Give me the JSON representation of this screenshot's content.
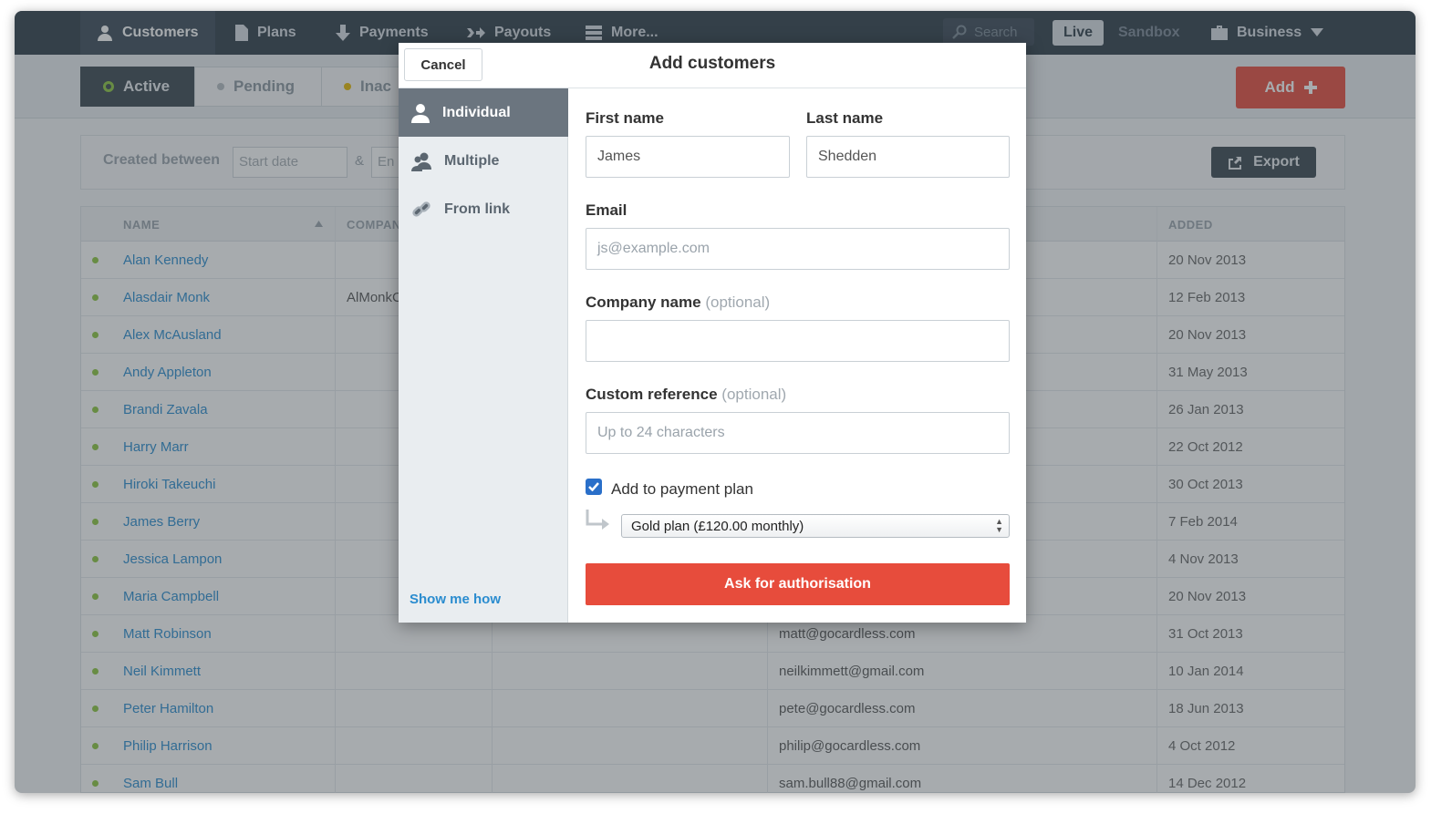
{
  "nav": {
    "items": [
      {
        "label": "Customers",
        "icon": "person-icon",
        "active": true
      },
      {
        "label": "Plans",
        "icon": "document-icon",
        "active": false
      },
      {
        "label": "Payments",
        "icon": "arrow-down-icon",
        "active": false
      },
      {
        "label": "Payouts",
        "icon": "arrow-right-icon",
        "active": false
      },
      {
        "label": "More...",
        "icon": "menu-icon",
        "active": false
      }
    ],
    "search_placeholder": "Search",
    "live_label": "Live",
    "sandbox_label": "Sandbox",
    "business_label": "Business"
  },
  "status_tabs": {
    "active": "Active",
    "pending": "Pending",
    "inactive": "Inac"
  },
  "add_button": "Add",
  "filters": {
    "created_between": "Created between",
    "start_placeholder": "Start date",
    "amp": "&",
    "end_placeholder": "En",
    "export_label": "Export"
  },
  "table": {
    "headers": {
      "name": "NAME",
      "company": "COMPAN",
      "added": "ADDED"
    },
    "rows": [
      {
        "name": "Alan Kennedy",
        "company": "",
        "email": "",
        "added": "20 Nov 2013"
      },
      {
        "name": "Alasdair Monk",
        "company": "AlMonkC",
        "email": "",
        "added": "12 Feb 2013"
      },
      {
        "name": "Alex McAusland",
        "company": "",
        "email": "",
        "added": "20 Nov 2013"
      },
      {
        "name": "Andy Appleton",
        "company": "",
        "email": "",
        "added": "31 May 2013"
      },
      {
        "name": "Brandi Zavala",
        "company": "",
        "email": "",
        "added": "26 Jan 2013"
      },
      {
        "name": "Harry Marr",
        "company": "",
        "email": "",
        "added": "22 Oct 2012"
      },
      {
        "name": "Hiroki Takeuchi",
        "company": "",
        "email": "",
        "added": "30 Oct 2013"
      },
      {
        "name": "James Berry",
        "company": "",
        "email": "",
        "added": "7 Feb 2014"
      },
      {
        "name": "Jessica Lampon",
        "company": "",
        "email": "",
        "added": "4 Nov 2013"
      },
      {
        "name": "Maria Campbell",
        "company": "",
        "email": "",
        "added": "20 Nov 2013"
      },
      {
        "name": "Matt Robinson",
        "company": "",
        "email": "matt@gocardless.com",
        "added": "31 Oct 2013"
      },
      {
        "name": "Neil Kimmett",
        "company": "",
        "email": "neilkimmett@gmail.com",
        "added": "10 Jan 2014"
      },
      {
        "name": "Peter Hamilton",
        "company": "",
        "email": "pete@gocardless.com",
        "added": "18 Jun 2013"
      },
      {
        "name": "Philip Harrison",
        "company": "",
        "email": "philip@gocardless.com",
        "added": "4 Oct 2012"
      },
      {
        "name": "Sam Bull",
        "company": "",
        "email": "sam.bull88@gmail.com",
        "added": "14 Dec 2012"
      }
    ]
  },
  "modal": {
    "title": "Add customers",
    "cancel_label": "Cancel",
    "side": {
      "individual": "Individual",
      "multiple": "Multiple",
      "from_link": "From link",
      "show_me_how": "Show me how"
    },
    "form": {
      "first_name_label": "First name",
      "first_name_value": "James",
      "last_name_label": "Last name",
      "last_name_value": "Shedden",
      "email_label": "Email",
      "email_placeholder": "js@example.com",
      "company_label": "Company name",
      "company_optional": "(optional)",
      "company_value": "",
      "reference_label": "Custom reference",
      "reference_optional": "(optional)",
      "reference_placeholder": "Up to 24 characters",
      "add_to_plan_label": "Add to payment plan",
      "add_to_plan_checked": true,
      "plan_selected": "Gold plan (£120.00 monthly)",
      "submit_label": "Ask for authorisation"
    }
  },
  "colors": {
    "nav_bg": "#2f3c48",
    "accent_red": "#e74c3c",
    "link_blue": "#2a8ccf",
    "status_green": "#8dc63f",
    "pending_grey": "#b5bcc2",
    "inactive_yellow": "#e6b800"
  }
}
